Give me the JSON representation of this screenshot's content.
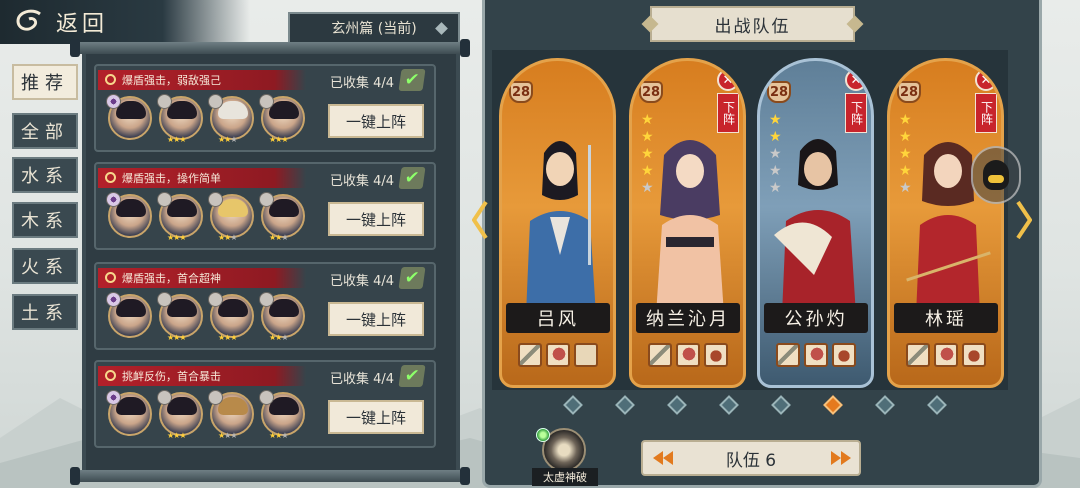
{
  "back_label": "返回",
  "chapter_label": "玄州篇 (当前)",
  "tabs": [
    "推荐",
    "全部",
    "水系",
    "木系",
    "火系",
    "土系"
  ],
  "team_cards": [
    {
      "title": "爆盾强击，弱敌强己",
      "collected": "已收集 4/4",
      "deploy": "一键上阵"
    },
    {
      "title": "爆盾强击，操作简单",
      "collected": "已收集 4/4",
      "deploy": "一键上阵"
    },
    {
      "title": "爆盾强击，首合超神",
      "collected": "已收集 4/4",
      "deploy": "一键上阵"
    },
    {
      "title": "挑衅反伤，首合暴击",
      "collected": "已收集 4/4",
      "deploy": "一键上阵"
    }
  ],
  "panel_title": "出战队伍",
  "heroes": [
    {
      "name": "吕风",
      "level": "28",
      "stars_on": 0,
      "stars_total": 0,
      "removable": false,
      "theme": "orange"
    },
    {
      "name": "纳兰沁月",
      "level": "28",
      "stars_on": 4,
      "stars_total": 5,
      "removable": true,
      "theme": "orange"
    },
    {
      "name": "公孙灼",
      "level": "28",
      "stars_on": 2,
      "stars_total": 5,
      "removable": true,
      "theme": "blue"
    },
    {
      "name": "林瑶",
      "level": "28",
      "stars_on": 4,
      "stars_total": 5,
      "removable": true,
      "theme": "orange"
    }
  ],
  "remove_label": "下阵",
  "remove_x": "✕",
  "team_label": "队伍 6",
  "skill_label": "太虚神破",
  "check_glyph": "✔",
  "page_dots": {
    "count": 8,
    "active_index": 5
  },
  "colors": {
    "accent_orange": "#e57a1e",
    "ribbon_red": "#b3202a",
    "panel_dark": "#33434a"
  },
  "icons": [
    "swirl-icon",
    "magnifier-icon",
    "check-icon",
    "chevron-left-icon",
    "chevron-right-icon",
    "chat-icon",
    "yin-yang-icon"
  ]
}
